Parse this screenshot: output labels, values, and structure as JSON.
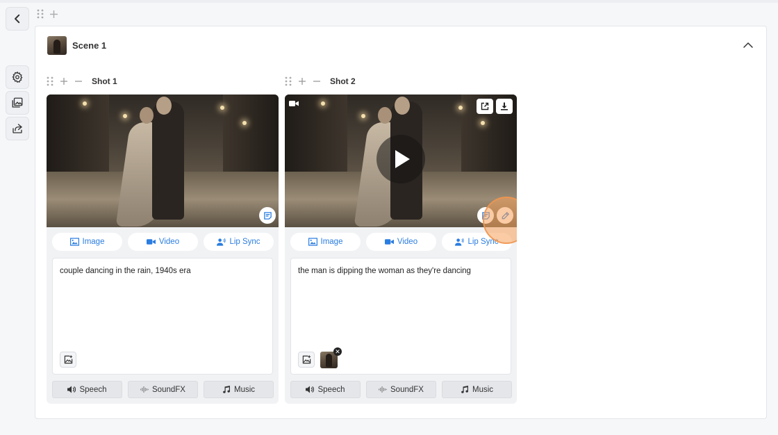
{
  "scene": {
    "title": "Scene 1"
  },
  "shots": [
    {
      "label": "Shot 1",
      "modes": [
        "Image",
        "Video",
        "Lip Sync"
      ],
      "prompt": "couple dancing in the rain, 1940s era",
      "audio": [
        "Speech",
        "SoundFX",
        "Music"
      ]
    },
    {
      "label": "Shot 2",
      "modes": [
        "Image",
        "Video",
        "Lip Sync"
      ],
      "prompt": "the man is dipping the woman as they're dancing",
      "audio": [
        "Speech",
        "SoundFX",
        "Music"
      ]
    }
  ],
  "colors": {
    "accent": "#2a7de1",
    "highlight": "#f6a05a"
  }
}
